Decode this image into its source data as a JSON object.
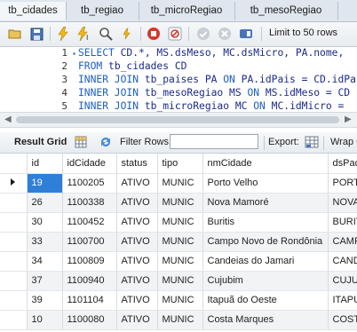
{
  "tabs": [
    "tb_cidades",
    "tb_regiao",
    "tb_microRegiao",
    "tb_mesoRegiao"
  ],
  "toolbar": {
    "icons": [
      "folder-open-icon",
      "save-icon",
      "lightning-icon",
      "lightning-cursor-icon",
      "magnifier-icon",
      "stop-icon",
      "no-error-icon",
      "check-icon",
      "cancel-icon",
      "toggle-icon"
    ],
    "limit_label": "Limit to 50 rows"
  },
  "editor": {
    "lines": [
      {
        "num": "1",
        "text": "SELECT CD.*, MS.dsMeso, MC.dsMicro, PA.nome,"
      },
      {
        "num": "2",
        "text": "FROM tb_cidades CD"
      },
      {
        "num": "3",
        "text": "INNER JOIN tb_paises PA ON PA.idPais = CD.idPa"
      },
      {
        "num": "4",
        "text": "INNER JOIN tb_mesoRegiao MS ON MS.idMeso = CD"
      },
      {
        "num": "5",
        "text": "INNER JOIN tb_microRegiao MC ON MC.idMicro ="
      }
    ]
  },
  "result_toolbar": {
    "result_grid": "Result Grid",
    "filter_rows": "Filter Rows:",
    "filter_value": "",
    "export": "Export:",
    "wrap": "Wrap C"
  },
  "grid": {
    "columns": [
      "id",
      "idCidade",
      "status",
      "tipo",
      "nmCidade",
      "dsPaco"
    ],
    "rows": [
      [
        "19",
        "1100205",
        "ATIVO",
        "MUNIC",
        "Porto Velho",
        "PORTO"
      ],
      [
        "26",
        "1100338",
        "ATIVO",
        "MUNIC",
        "Nova Mamoré",
        "NOVA M"
      ],
      [
        "30",
        "1100452",
        "ATIVO",
        "MUNIC",
        "Buritis",
        "BURITI"
      ],
      [
        "33",
        "1100700",
        "ATIVO",
        "MUNIC",
        "Campo Novo de Rondônia",
        "CAMPO"
      ],
      [
        "34",
        "1100809",
        "ATIVO",
        "MUNIC",
        "Candeias do Jamari",
        "CANDE"
      ],
      [
        "37",
        "1100940",
        "ATIVO",
        "MUNIC",
        "Cujubim",
        "CUJUB"
      ],
      [
        "39",
        "1101104",
        "ATIVO",
        "MUNIC",
        "Itapuã do Oeste",
        "ITAPU"
      ],
      [
        "10",
        "1100080",
        "ATIVO",
        "MUNIC",
        "Costa Marques",
        "COSTA"
      ]
    ],
    "selected_row": 0
  }
}
